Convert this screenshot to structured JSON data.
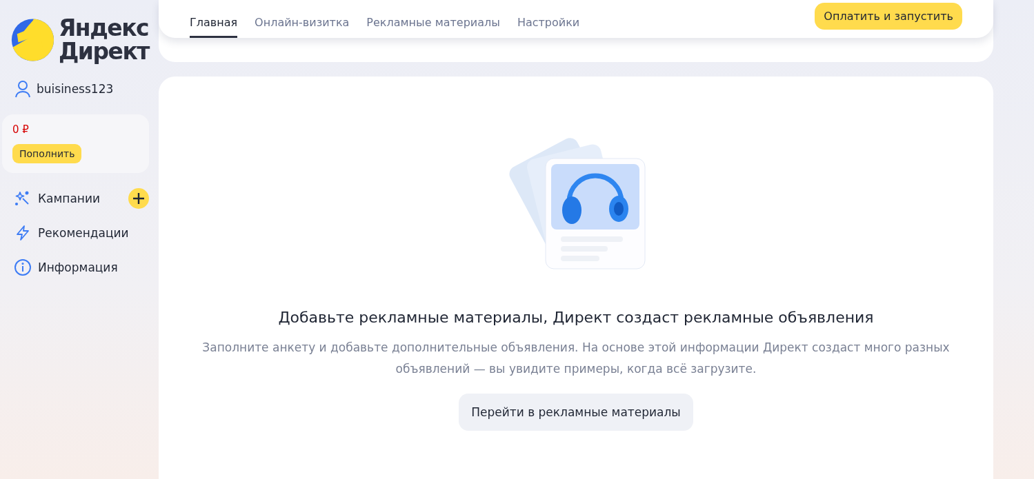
{
  "logo": {
    "lines": [
      "Яндекс",
      "Директ"
    ]
  },
  "user": {
    "name": "buisiness123"
  },
  "balance": {
    "amount": "0 ₽",
    "button": "Пополнить"
  },
  "nav": [
    {
      "label": "Кампании",
      "has_add": true
    },
    {
      "label": "Рекомендации",
      "has_add": false
    },
    {
      "label": "Информация",
      "has_add": false
    }
  ],
  "tabs": [
    {
      "label": "Главная",
      "selected": true
    },
    {
      "label": "Онлайн-визитка",
      "selected": false
    },
    {
      "label": "Рекламные материалы",
      "selected": false
    },
    {
      "label": "Настройки",
      "selected": false
    }
  ],
  "pay_button": "Оплатить и запустить",
  "empty_state": {
    "title": "Добавьте рекламные материалы, Директ создаст рекламные объявления",
    "description": "Заполните анкету и добавьте дополнительные объявления. На основе этой информации Директ создаст много разных объявлений — вы увидите примеры, когда всё загрузите.",
    "button": "Перейти в рекламные материалы"
  }
}
